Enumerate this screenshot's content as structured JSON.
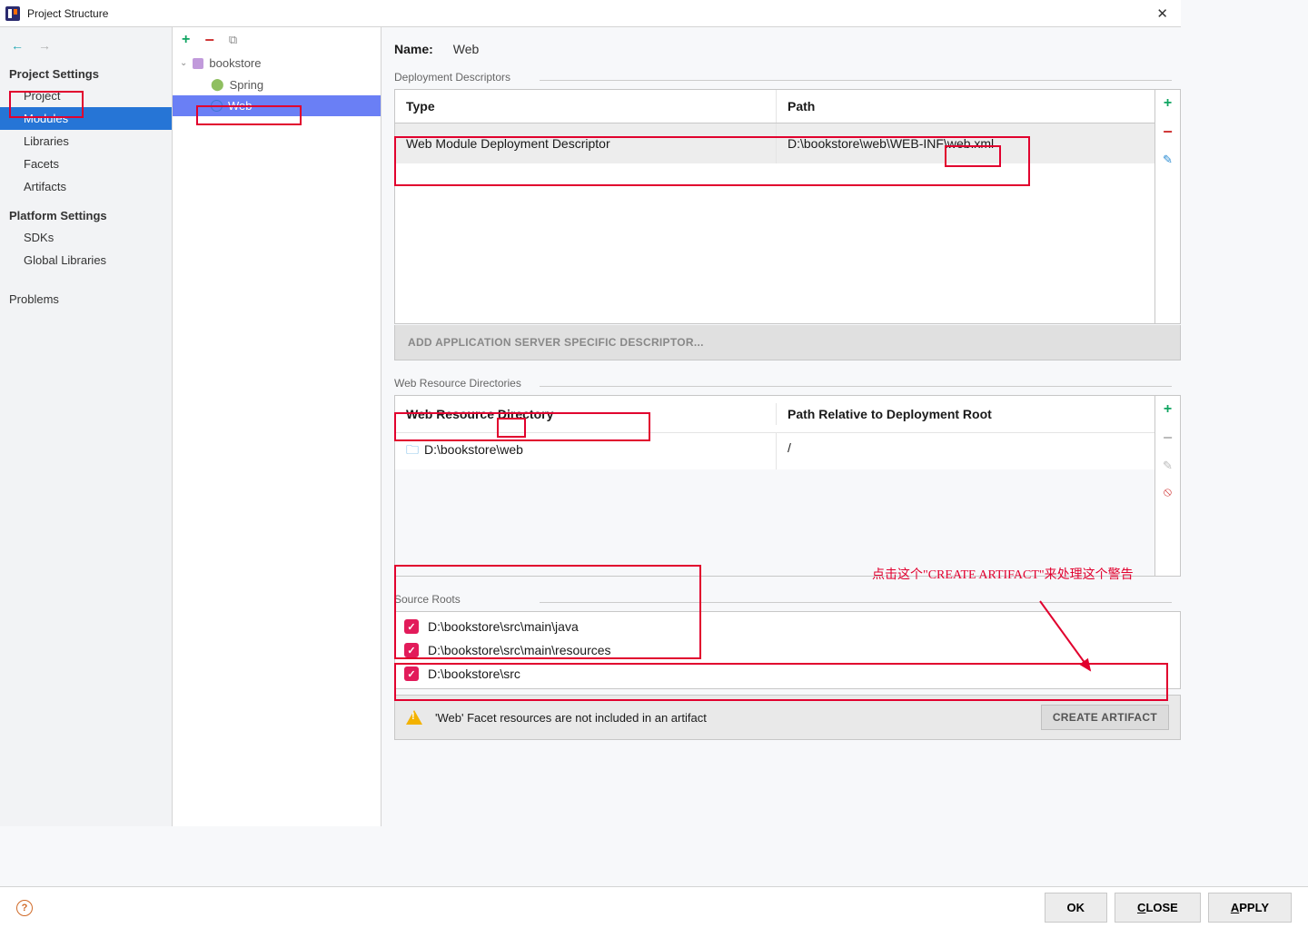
{
  "window": {
    "title": "Project Structure"
  },
  "nav": {
    "back": "←",
    "fwd": "→",
    "section1": "Project Settings",
    "items1": [
      "Project",
      "Modules",
      "Libraries",
      "Facets",
      "Artifacts"
    ],
    "section2": "Platform Settings",
    "items2": [
      "SDKs",
      "Global Libraries"
    ],
    "problems": "Problems"
  },
  "tree": {
    "root": "bookstore",
    "child_spring": "Spring",
    "child_web": "Web"
  },
  "main": {
    "name_label": "Name:",
    "name_value": "Web",
    "dd_legend": "Deployment Descriptors",
    "dd_col_type": "Type",
    "dd_col_path": "Path",
    "dd_row_type": "Web Module Deployment Descriptor",
    "dd_row_path": "D:\\bookstore\\web\\WEB-INF\\web.xml",
    "add_server_desc": "ADD APPLICATION SERVER SPECIFIC DESCRIPTOR...",
    "wrd_legend": "Web Resource Directories",
    "wrd_col_dir": "Web Resource Directory",
    "wrd_col_path": "Path Relative to Deployment Root",
    "wrd_row_dir": "D:\\bookstore\\web",
    "wrd_row_path": "/",
    "src_legend": "Source Roots",
    "src_roots": [
      "D:\\bookstore\\src\\main\\java",
      "D:\\bookstore\\src\\main\\resources",
      "D:\\bookstore\\src"
    ],
    "warn_text": "'Web' Facet resources are not included in an artifact",
    "create_artifact": "CREATE ARTIFACT"
  },
  "footer": {
    "ok": "OK",
    "close": "CLOSE",
    "apply": "APPLY"
  },
  "annotation": "点击这个\"CREATE ARTIFACT\"来处理这个警告"
}
